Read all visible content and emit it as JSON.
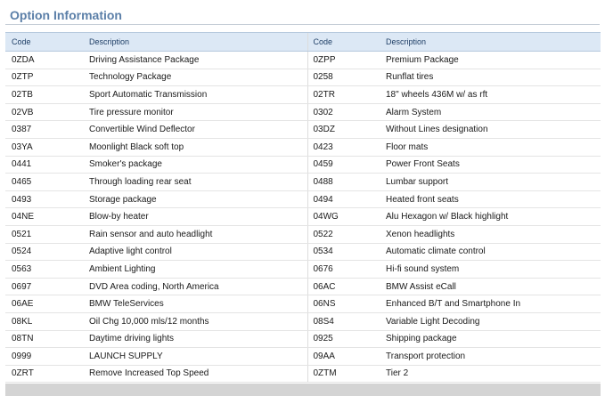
{
  "section": {
    "title": "Option Information"
  },
  "table": {
    "headers": {
      "code": "Code",
      "description": "Description"
    },
    "rows": [
      {
        "code1": "0ZDA",
        "desc1": "Driving Assistance Package",
        "code2": "0ZPP",
        "desc2": "Premium Package"
      },
      {
        "code1": "0ZTP",
        "desc1": "Technology Package",
        "code2": "0258",
        "desc2": "Runflat tires"
      },
      {
        "code1": "02TB",
        "desc1": "Sport Automatic Transmission",
        "code2": "02TR",
        "desc2": "18\" wheels 436M w/ as rft"
      },
      {
        "code1": "02VB",
        "desc1": "Tire pressure monitor",
        "code2": "0302",
        "desc2": "Alarm System"
      },
      {
        "code1": "0387",
        "desc1": "Convertible Wind Deflector",
        "code2": "03DZ",
        "desc2": "Without Lines designation"
      },
      {
        "code1": "03YA",
        "desc1": "Moonlight Black soft top",
        "code2": "0423",
        "desc2": "Floor mats"
      },
      {
        "code1": "0441",
        "desc1": "Smoker's package",
        "code2": "0459",
        "desc2": "Power Front Seats"
      },
      {
        "code1": "0465",
        "desc1": "Through loading rear seat",
        "code2": "0488",
        "desc2": "Lumbar support"
      },
      {
        "code1": "0493",
        "desc1": "Storage package",
        "code2": "0494",
        "desc2": "Heated front seats"
      },
      {
        "code1": "04NE",
        "desc1": "Blow-by heater",
        "code2": "04WG",
        "desc2": "Alu Hexagon w/ Black highlight"
      },
      {
        "code1": "0521",
        "desc1": "Rain sensor and auto headlight",
        "code2": "0522",
        "desc2": "Xenon headlights"
      },
      {
        "code1": "0524",
        "desc1": "Adaptive light control",
        "code2": "0534",
        "desc2": "Automatic climate control"
      },
      {
        "code1": "0563",
        "desc1": "Ambient Lighting",
        "code2": "0676",
        "desc2": "Hi-fi sound system"
      },
      {
        "code1": "0697",
        "desc1": "DVD Area coding, North America",
        "code2": "06AC",
        "desc2": "BMW Assist eCall"
      },
      {
        "code1": "06AE",
        "desc1": "BMW TeleServices",
        "code2": "06NS",
        "desc2": "Enhanced B/T and Smartphone In"
      },
      {
        "code1": "08KL",
        "desc1": "Oil Chg 10,000 mls/12 months",
        "code2": "08S4",
        "desc2": "Variable Light Decoding"
      },
      {
        "code1": "08TN",
        "desc1": "Daytime driving lights",
        "code2": "0925",
        "desc2": "Shipping package"
      },
      {
        "code1": "0999",
        "desc1": "LAUNCH SUPPLY",
        "code2": "09AA",
        "desc2": "Transport protection"
      },
      {
        "code1": "0ZRT",
        "desc1": "Remove Increased Top Speed",
        "code2": "0ZTM",
        "desc2": "Tier 2"
      }
    ]
  }
}
